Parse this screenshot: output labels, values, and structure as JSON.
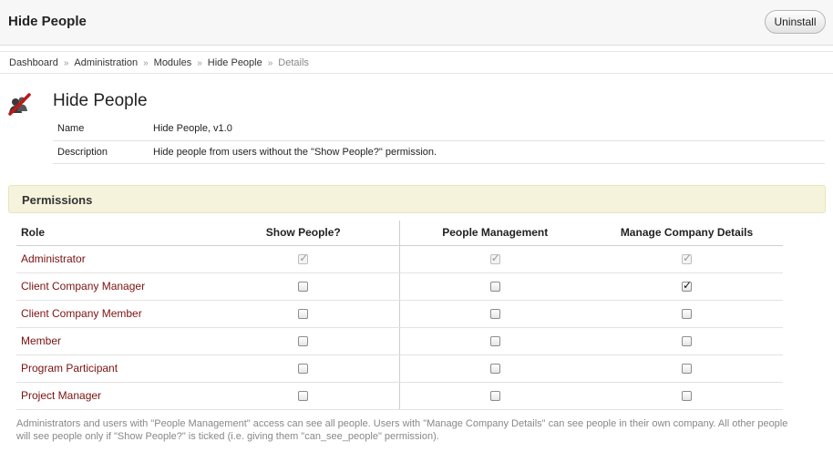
{
  "header": {
    "title": "Hide People",
    "uninstall_label": "Uninstall"
  },
  "breadcrumb": {
    "items": [
      "Dashboard",
      "Administration",
      "Modules",
      "Hide People"
    ],
    "current": "Details",
    "separator": "»"
  },
  "module": {
    "icon": "hide-people-icon",
    "title": "Hide People",
    "details": [
      {
        "key": "Name",
        "value": "Hide People, v1.0"
      },
      {
        "key": "Description",
        "value": "Hide people from users without the \"Show People?\" permission."
      }
    ]
  },
  "permissions": {
    "section_title": "Permissions",
    "columns": [
      "Role",
      "Show People?",
      "People Management",
      "Manage Company Details"
    ],
    "rows": [
      {
        "role": "Administrator",
        "values": [
          true,
          true,
          true
        ],
        "disabled": [
          true,
          true,
          true
        ]
      },
      {
        "role": "Client Company Manager",
        "values": [
          false,
          false,
          true
        ],
        "disabled": [
          false,
          false,
          false
        ]
      },
      {
        "role": "Client Company Member",
        "values": [
          false,
          false,
          false
        ],
        "disabled": [
          false,
          false,
          false
        ]
      },
      {
        "role": "Member",
        "values": [
          false,
          false,
          false
        ],
        "disabled": [
          false,
          false,
          false
        ]
      },
      {
        "role": "Program Participant",
        "values": [
          false,
          false,
          false
        ],
        "disabled": [
          false,
          false,
          false
        ]
      },
      {
        "role": "Project Manager",
        "values": [
          false,
          false,
          false
        ],
        "disabled": [
          false,
          false,
          false
        ]
      }
    ],
    "footnote": "Administrators and users with \"People Management\" access can see all people. Users with \"Manage Company Details\" can see people in their own company. All other people will see people only if \"Show People?\" is ticked (i.e. giving them \"can_see_people\" permission)."
  },
  "colors": {
    "role_link": "#7a1212",
    "section_header_bg": "#f6f3dc",
    "icon_red": "#c0171b"
  }
}
